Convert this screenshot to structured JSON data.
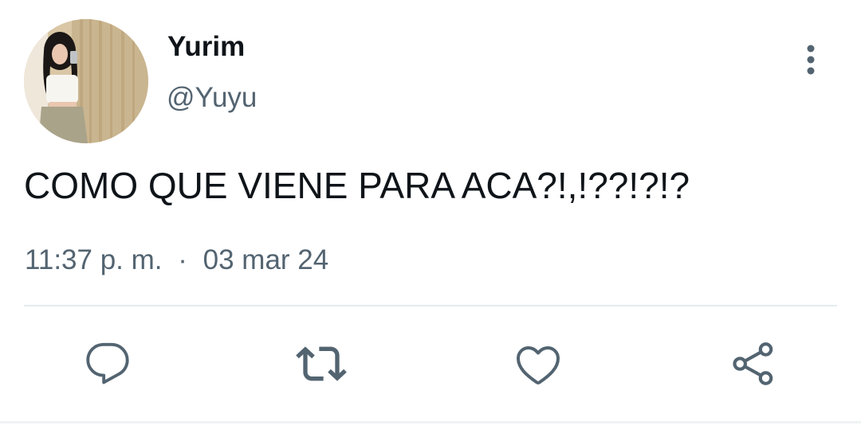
{
  "tweet": {
    "display_name": "Yurim",
    "handle": "@Yuyu",
    "text": "COMO QUE VIENE PARA ACA?!,!??!?!?",
    "time": "11:37 p. m.",
    "separator": "·",
    "date": "03 mar 24"
  },
  "icons": {
    "more": "more-vertical-icon",
    "reply": "reply-icon",
    "retweet": "retweet-icon",
    "like": "heart-icon",
    "share": "share-icon"
  },
  "colors": {
    "text": "#0f1419",
    "secondary": "#536471",
    "divider": "#e6ecf0"
  }
}
